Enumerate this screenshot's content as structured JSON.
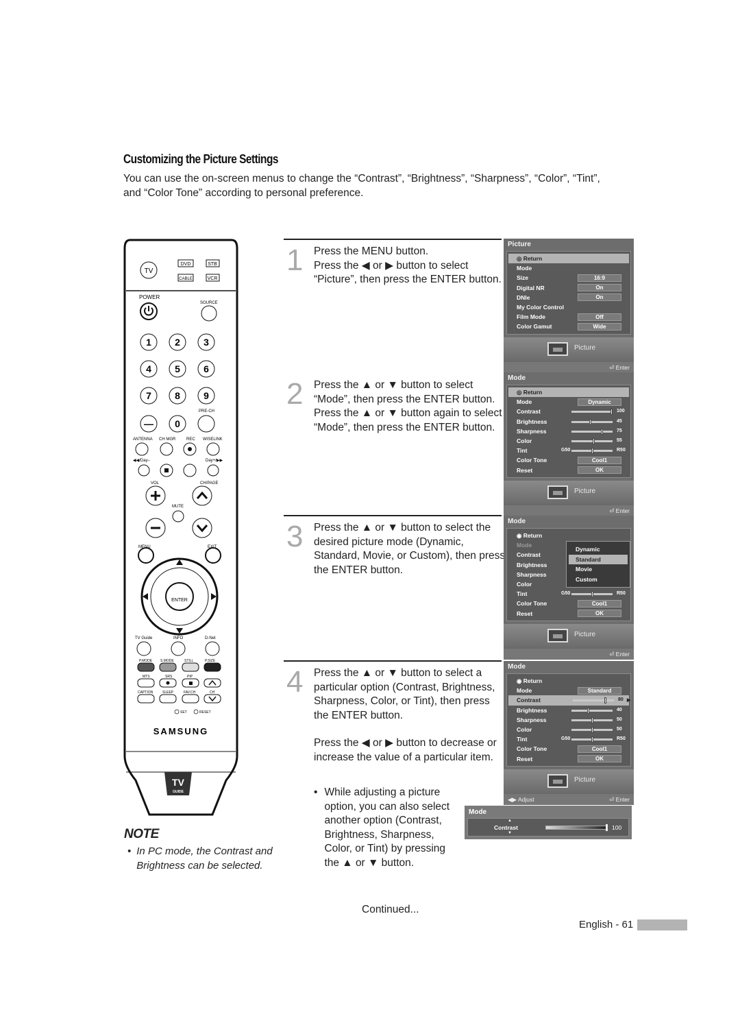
{
  "page": {
    "title": "Customizing the Picture Settings",
    "intro": "You can use the on-screen menus to change the “Contrast”, “Brightness”, “Sharpness”, “Color”, “Tint”, and “Color Tone” according to personal preference.",
    "continued": "Continued...",
    "page_number": "English - 61"
  },
  "remote": {
    "source_buttons": [
      "TV",
      "DVD",
      "STB",
      "CABLE",
      "VCR"
    ],
    "labels": {
      "power": "POWER",
      "source": "SOURCE",
      "prech": "PRE-CH",
      "antenna": "ANTENNA",
      "chmgr": "CH MGR",
      "rec": "REC",
      "wiselink": "WISELINK",
      "day_minus": "◀◀/Day–",
      "day_plus": "Day+/▶▶",
      "vol": "VOL",
      "chpage": "CH/PAGE",
      "mute": "MUTE",
      "menu": "MENU",
      "exit": "EXIT",
      "enter": "ENTER",
      "tvguide": "TV Guide",
      "info": "INFO",
      "dnet": "D-Net",
      "pmode": "P.MODE",
      "smode": "S.MODE",
      "still": "STILL",
      "psize": "P.SIZE",
      "mts": "MTS",
      "srs": "SRS",
      "pip": "PIP",
      "caption": "CAPTION",
      "sleep": "SLEEP",
      "favch": "FAV.CH",
      "ch": "CH",
      "set": "SET",
      "reset": "RESET",
      "brand": "SAMSUNG",
      "tvguide_logo_top": "TV",
      "tvguide_logo_bottom": "GUIDE"
    },
    "digits": [
      "1",
      "2",
      "3",
      "4",
      "5",
      "6",
      "7",
      "8",
      "9",
      "—",
      "0"
    ]
  },
  "note": {
    "title": "NOTE",
    "text": "In PC mode, the Contrast and Brightness can be selected."
  },
  "steps": [
    {
      "number": "1",
      "paragraphs": [
        "Press the MENU button.",
        "Press the ◀ or ▶ button to select “Picture”, then press the ENTER button."
      ]
    },
    {
      "number": "2",
      "paragraphs": [
        "Press the ▲ or ▼ button to select “Mode”, then press the ENTER button.",
        "Press the ▲ or ▼ button again to select “Mode”, then press the ENTER button."
      ]
    },
    {
      "number": "3",
      "paragraphs": [
        "Press the ▲ or ▼ button to select the desired picture mode (Dynamic, Standard, Movie, or Custom), then press the ENTER button."
      ]
    },
    {
      "number": "4",
      "paragraphs": [
        "Press the ▲ or ▼ button to select a particular option (Contrast, Brightness, Sharpness, Color, or Tint), then press the ENTER button.",
        "Press the ◀ or ▶ button to decrease or increase the value of a particular item."
      ]
    }
  ],
  "bullet": "While adjusting a picture option, you can also select another option (Contrast, Brightness, Sharpness, Color, or Tint) by pressing the ▲ or ▼ button.",
  "osd": {
    "return": "Return",
    "footer_label": "Picture",
    "enter": "Enter",
    "adjust": "Adjust",
    "screen1": {
      "title": "Picture",
      "rows": [
        {
          "label": "Mode",
          "value": ""
        },
        {
          "label": "Size",
          "value": "16:9"
        },
        {
          "label": "Digital NR",
          "value": "On"
        },
        {
          "label": "DNIe",
          "value": "On"
        },
        {
          "label": "My Color Control",
          "value": ""
        },
        {
          "label": "Film Mode",
          "value": "Off"
        },
        {
          "label": "Color Gamut",
          "value": "Wide"
        }
      ]
    },
    "screen2": {
      "title": "Mode",
      "mode_label": "Mode",
      "mode_value": "Dynamic",
      "sliders": [
        {
          "label": "Contrast",
          "value": "100",
          "level": 1.0
        },
        {
          "label": "Brightness",
          "value": "45",
          "level": 0.45
        },
        {
          "label": "Sharpness",
          "value": "75",
          "level": 0.75
        },
        {
          "label": "Color",
          "value": "55",
          "level": 0.55
        },
        {
          "label": "Tint",
          "left": "G50",
          "right": "R50",
          "level": 0.5
        }
      ],
      "color_tone_label": "Color Tone",
      "color_tone": "Cool1",
      "reset_label": "Reset",
      "reset": "OK"
    },
    "screen3": {
      "title": "Mode",
      "labels": [
        "Mode",
        "Contrast",
        "Brightness",
        "Sharpness",
        "Color"
      ],
      "options": [
        "Dynamic",
        "Standard",
        "Movie",
        "Custom"
      ],
      "selected": "Standard",
      "tint": {
        "label": "Tint",
        "left": "G50",
        "right": "R50",
        "level": 0.5
      },
      "color_tone_label": "Color Tone",
      "color_tone": "Cool1",
      "reset_label": "Reset",
      "reset": "OK"
    },
    "screen4": {
      "title": "Mode",
      "mode_label": "Mode",
      "mode_value": "Standard",
      "sliders": [
        {
          "label": "Contrast",
          "value": "80",
          "level": 0.8
        },
        {
          "label": "Brightness",
          "value": "40",
          "level": 0.4
        },
        {
          "label": "Sharpness",
          "value": "50",
          "level": 0.5
        },
        {
          "label": "Color",
          "value": "50",
          "level": 0.5
        },
        {
          "label": "Tint",
          "left": "G50",
          "right": "R50",
          "level": 0.5
        }
      ],
      "color_tone_label": "Color Tone",
      "color_tone": "Cool1",
      "reset_label": "Reset",
      "reset": "OK"
    },
    "mini": {
      "title": "Mode",
      "label": "Contrast",
      "value": "100",
      "level": 1.0
    }
  }
}
